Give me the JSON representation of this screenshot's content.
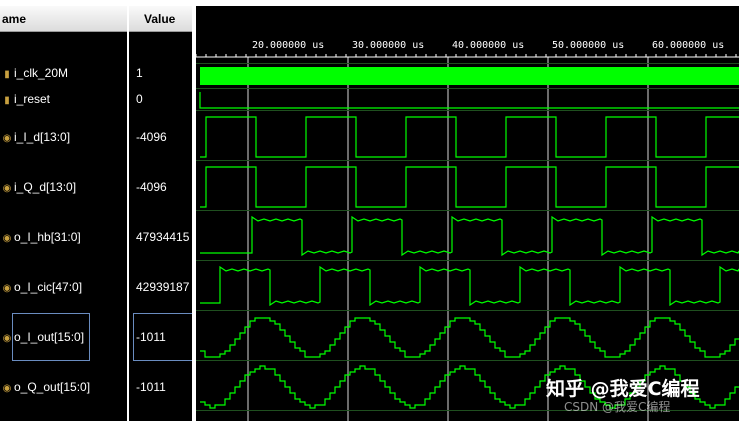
{
  "headers": {
    "name": "ame",
    "value": "Value"
  },
  "signals": [
    {
      "name": "i_clk_20M",
      "value": "1",
      "icon": "bit-signal-icon"
    },
    {
      "name": "i_reset",
      "value": "0",
      "icon": "bit-signal-icon"
    },
    {
      "name": "i_I_d[13:0]",
      "value": "-4096",
      "icon": "bus-signal-icon"
    },
    {
      "name": "i_Q_d[13:0]",
      "value": "-4096",
      "icon": "bus-signal-icon"
    },
    {
      "name": "o_I_hb[31:0]",
      "value": "47934415",
      "icon": "bus-signal-icon"
    },
    {
      "name": "o_I_cic[47:0]",
      "value": "42939187",
      "icon": "bus-signal-icon"
    },
    {
      "name": "o_I_out[15:0]",
      "value": "-1011",
      "icon": "bus-signal-icon",
      "selected": true
    },
    {
      "name": "o_Q_out[15:0]",
      "value": "-1011",
      "icon": "bus-signal-icon"
    }
  ],
  "timeline": {
    "labels": [
      "20.000000 us",
      "30.000000 us",
      "40.000000 us",
      "50.000000 us",
      "60.000000 us"
    ]
  },
  "watermark": {
    "main": "知乎 @我爱C编程",
    "sub": "CSDN @我爱C编程"
  },
  "colors": {
    "wave": "#00ff00",
    "background": "#000000",
    "cursor": "#ffffff"
  }
}
